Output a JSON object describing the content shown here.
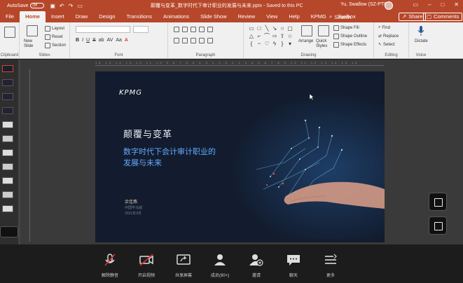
{
  "titlebar": {
    "autosave_label": "AutoSave",
    "autosave_state": "Off",
    "document_title": "颠覆与变革_数字时代下审计职业的发展与未来.pptx - Saved to this PC",
    "user_name": "Yu, Swallow (SZ-PTR)"
  },
  "tabs": {
    "items": [
      "File",
      "Home",
      "Insert",
      "Draw",
      "Design",
      "Transitions",
      "Animations",
      "Slide Show",
      "Review",
      "View",
      "Help",
      "KPMG",
      "Toolbox"
    ],
    "active": "Home",
    "search_label": "Search",
    "share_label": "Share",
    "comments_label": "Comments"
  },
  "ribbon": {
    "clipboard_label": "Clipboard",
    "new_slide_label": "New Slide",
    "layout_label": "Layout",
    "reset_label": "Reset",
    "section_label": "Section",
    "slides_label": "Slides",
    "font_label": "Font",
    "paragraph_label": "Paragraph",
    "arrange_label": "Arrange",
    "quick_styles_label": "Quick Styles",
    "shape_fill_label": "Shape Fill",
    "shape_outline_label": "Shape Outline",
    "shape_effects_label": "Shape Effects",
    "drawing_label": "Drawing",
    "find_label": "Find",
    "replace_label": "Replace",
    "select_label": "Select",
    "editing_label": "Editing",
    "dictate_label": "Dictate",
    "voice_label": "Voice",
    "format_buttons": [
      "B",
      "I",
      "U",
      "S",
      "ab",
      "AV",
      "Aa",
      "A"
    ]
  },
  "slide": {
    "logo": "KPMG",
    "title_line1": "颠覆与变革",
    "title_line2": "数字时代下会计审计职业的",
    "title_line3": "发展与未来",
    "author": "余佳燕",
    "author_line2": "中国毕马威",
    "author_line3": "2021年3月"
  },
  "meeting": {
    "buttons": [
      {
        "icon": "mic-muted-icon",
        "label": "解除静音"
      },
      {
        "icon": "camera-off-icon",
        "label": "开启视频"
      },
      {
        "icon": "share-screen-icon",
        "label": "共享屏幕"
      },
      {
        "icon": "participants-icon",
        "label": "成员(90+)"
      },
      {
        "icon": "invite-icon",
        "label": "邀请"
      },
      {
        "icon": "chat-icon",
        "label": "聊天"
      },
      {
        "icon": "more-icon",
        "label": "更多"
      }
    ]
  },
  "colors": {
    "accent": "#b7472a",
    "slide_bg": "#121c2e",
    "slide_subtitle": "#63a9ff",
    "meeting_bar": "#1c1c1c"
  }
}
